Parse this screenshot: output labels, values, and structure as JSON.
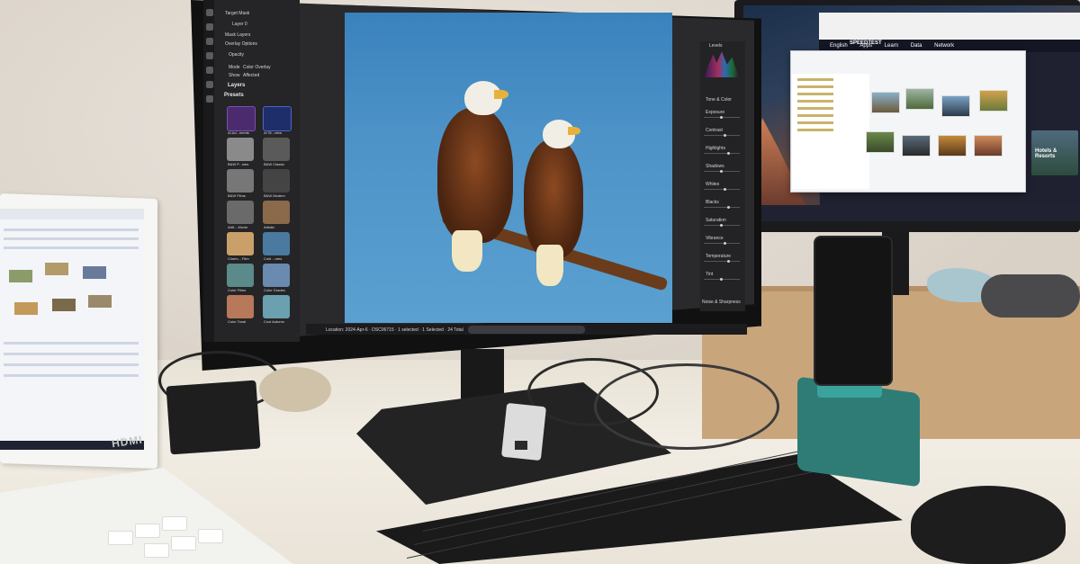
{
  "scene": {
    "description_labels": {
      "laptop_brand_text": "HDMI"
    }
  },
  "main_monitor": {
    "left_panel": {
      "target_mask_label": "Target Mask",
      "layer_name": "Layer 0",
      "mask_layers_label": "Mask Layers",
      "overlay_options_label": "Overlay Options",
      "opacity_label": "Opacity",
      "mode_label": "Mode",
      "mode_value": "Color Overlay",
      "show_label": "Show",
      "show_value": "Affected",
      "layers_title": "Layers",
      "presets_title": "Presets",
      "presets": [
        {
          "label": "AI Ad...ments"
        },
        {
          "label": "AI St...view"
        },
        {
          "label": "B&W P...mes"
        },
        {
          "label": "B&W Classic"
        },
        {
          "label": "B&W Films"
        },
        {
          "label": "B&W Modern"
        },
        {
          "label": "Artif... Movie"
        },
        {
          "label": "Artistic"
        },
        {
          "label": "Cinem... Film"
        },
        {
          "label": "Cold ...mes"
        },
        {
          "label": "Color Films"
        },
        {
          "label": "Color Grades"
        },
        {
          "label": "Color Tonal"
        },
        {
          "label": "Cool Autumn"
        }
      ]
    },
    "right_panel": {
      "panel_title": "Levels",
      "section_title": "Tone & Color",
      "sections": [
        "Exposure",
        "Contrast",
        "Highlights",
        "Shadows",
        "Whites",
        "Blacks",
        "Saturation",
        "Vibrance",
        "Temperature",
        "Tint"
      ],
      "footer_label": "Noise & Sharpness"
    },
    "status_bar_text": "Location: 2024-Apr-6 · DSC06715 · 1 selected · 1 Selected · 24 Total"
  },
  "second_monitor": {
    "speedtest_logo": "SPEEDTEST",
    "speedtest_nav": [
      "English",
      "Apps",
      "Learn",
      "Data",
      "Network"
    ],
    "hotel_card_text": "Hotels & Resorts"
  },
  "colors": {
    "sky": "#4d93c8",
    "eagle_brown": "#6b3518",
    "eagle_white": "#f1eee6",
    "beak_yellow": "#e8b23a",
    "phone_stand_teal": "#2f7c76",
    "cardboard": "#c9a57c"
  }
}
